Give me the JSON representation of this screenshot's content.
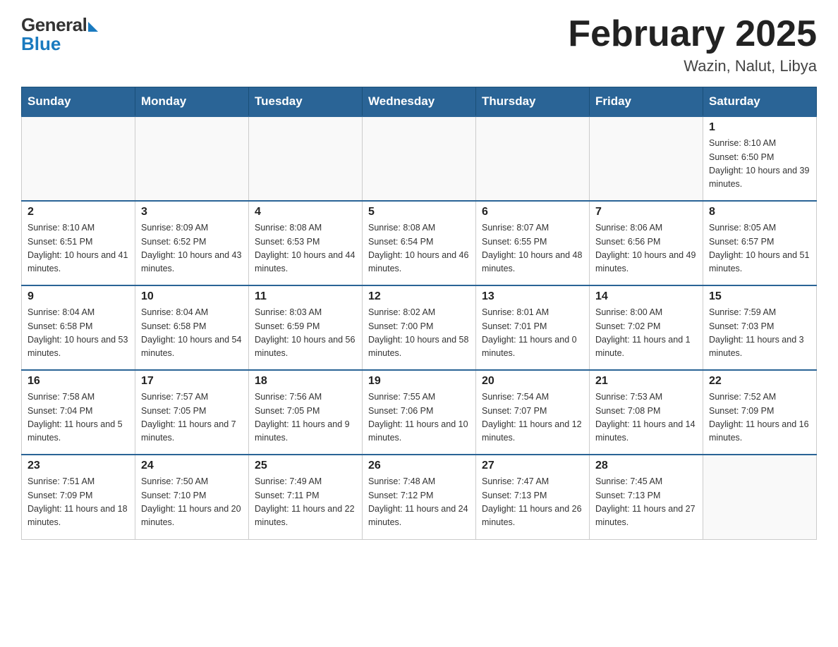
{
  "header": {
    "logo_general": "General",
    "logo_blue": "Blue",
    "month_title": "February 2025",
    "location": "Wazin, Nalut, Libya"
  },
  "days_of_week": [
    "Sunday",
    "Monday",
    "Tuesday",
    "Wednesday",
    "Thursday",
    "Friday",
    "Saturday"
  ],
  "weeks": [
    [
      {
        "day": "",
        "info": ""
      },
      {
        "day": "",
        "info": ""
      },
      {
        "day": "",
        "info": ""
      },
      {
        "day": "",
        "info": ""
      },
      {
        "day": "",
        "info": ""
      },
      {
        "day": "",
        "info": ""
      },
      {
        "day": "1",
        "info": "Sunrise: 8:10 AM\nSunset: 6:50 PM\nDaylight: 10 hours and 39 minutes."
      }
    ],
    [
      {
        "day": "2",
        "info": "Sunrise: 8:10 AM\nSunset: 6:51 PM\nDaylight: 10 hours and 41 minutes."
      },
      {
        "day": "3",
        "info": "Sunrise: 8:09 AM\nSunset: 6:52 PM\nDaylight: 10 hours and 43 minutes."
      },
      {
        "day": "4",
        "info": "Sunrise: 8:08 AM\nSunset: 6:53 PM\nDaylight: 10 hours and 44 minutes."
      },
      {
        "day": "5",
        "info": "Sunrise: 8:08 AM\nSunset: 6:54 PM\nDaylight: 10 hours and 46 minutes."
      },
      {
        "day": "6",
        "info": "Sunrise: 8:07 AM\nSunset: 6:55 PM\nDaylight: 10 hours and 48 minutes."
      },
      {
        "day": "7",
        "info": "Sunrise: 8:06 AM\nSunset: 6:56 PM\nDaylight: 10 hours and 49 minutes."
      },
      {
        "day": "8",
        "info": "Sunrise: 8:05 AM\nSunset: 6:57 PM\nDaylight: 10 hours and 51 minutes."
      }
    ],
    [
      {
        "day": "9",
        "info": "Sunrise: 8:04 AM\nSunset: 6:58 PM\nDaylight: 10 hours and 53 minutes."
      },
      {
        "day": "10",
        "info": "Sunrise: 8:04 AM\nSunset: 6:58 PM\nDaylight: 10 hours and 54 minutes."
      },
      {
        "day": "11",
        "info": "Sunrise: 8:03 AM\nSunset: 6:59 PM\nDaylight: 10 hours and 56 minutes."
      },
      {
        "day": "12",
        "info": "Sunrise: 8:02 AM\nSunset: 7:00 PM\nDaylight: 10 hours and 58 minutes."
      },
      {
        "day": "13",
        "info": "Sunrise: 8:01 AM\nSunset: 7:01 PM\nDaylight: 11 hours and 0 minutes."
      },
      {
        "day": "14",
        "info": "Sunrise: 8:00 AM\nSunset: 7:02 PM\nDaylight: 11 hours and 1 minute."
      },
      {
        "day": "15",
        "info": "Sunrise: 7:59 AM\nSunset: 7:03 PM\nDaylight: 11 hours and 3 minutes."
      }
    ],
    [
      {
        "day": "16",
        "info": "Sunrise: 7:58 AM\nSunset: 7:04 PM\nDaylight: 11 hours and 5 minutes."
      },
      {
        "day": "17",
        "info": "Sunrise: 7:57 AM\nSunset: 7:05 PM\nDaylight: 11 hours and 7 minutes."
      },
      {
        "day": "18",
        "info": "Sunrise: 7:56 AM\nSunset: 7:05 PM\nDaylight: 11 hours and 9 minutes."
      },
      {
        "day": "19",
        "info": "Sunrise: 7:55 AM\nSunset: 7:06 PM\nDaylight: 11 hours and 10 minutes."
      },
      {
        "day": "20",
        "info": "Sunrise: 7:54 AM\nSunset: 7:07 PM\nDaylight: 11 hours and 12 minutes."
      },
      {
        "day": "21",
        "info": "Sunrise: 7:53 AM\nSunset: 7:08 PM\nDaylight: 11 hours and 14 minutes."
      },
      {
        "day": "22",
        "info": "Sunrise: 7:52 AM\nSunset: 7:09 PM\nDaylight: 11 hours and 16 minutes."
      }
    ],
    [
      {
        "day": "23",
        "info": "Sunrise: 7:51 AM\nSunset: 7:09 PM\nDaylight: 11 hours and 18 minutes."
      },
      {
        "day": "24",
        "info": "Sunrise: 7:50 AM\nSunset: 7:10 PM\nDaylight: 11 hours and 20 minutes."
      },
      {
        "day": "25",
        "info": "Sunrise: 7:49 AM\nSunset: 7:11 PM\nDaylight: 11 hours and 22 minutes."
      },
      {
        "day": "26",
        "info": "Sunrise: 7:48 AM\nSunset: 7:12 PM\nDaylight: 11 hours and 24 minutes."
      },
      {
        "day": "27",
        "info": "Sunrise: 7:47 AM\nSunset: 7:13 PM\nDaylight: 11 hours and 26 minutes."
      },
      {
        "day": "28",
        "info": "Sunrise: 7:45 AM\nSunset: 7:13 PM\nDaylight: 11 hours and 27 minutes."
      },
      {
        "day": "",
        "info": ""
      }
    ]
  ]
}
